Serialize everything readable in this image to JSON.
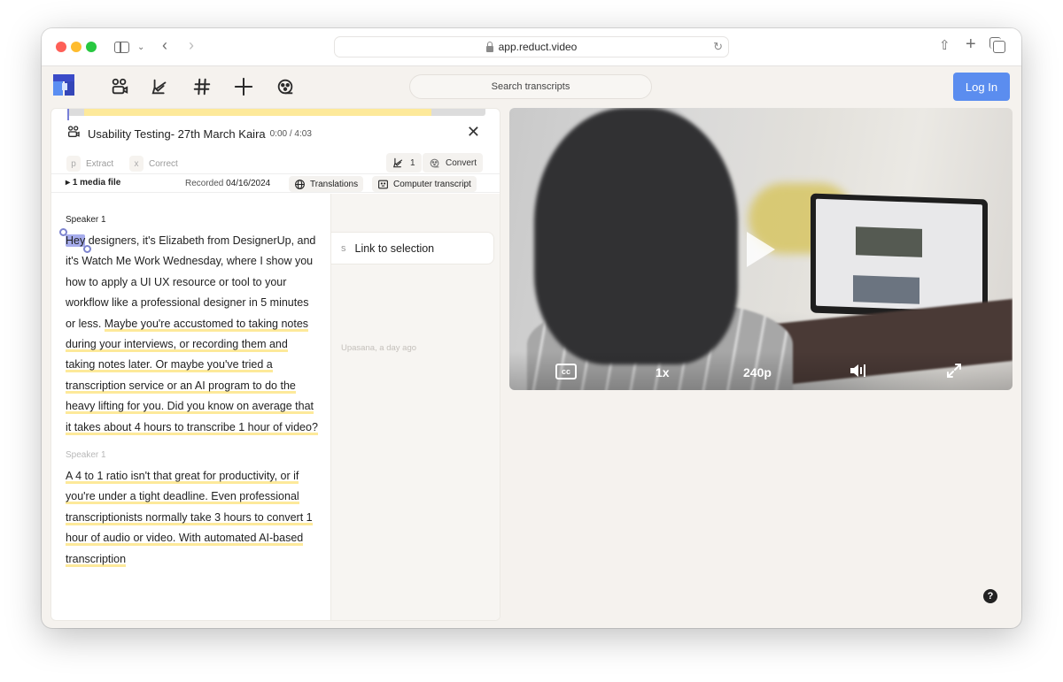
{
  "browser": {
    "url": "app.reduct.video",
    "icons": [
      "sidebar-icon",
      "chevron-down-icon",
      "back-icon",
      "forward-icon",
      "lock-icon",
      "reload-icon",
      "share-icon",
      "new-tab-icon",
      "tabs-overview-icon"
    ]
  },
  "toolbar": {
    "icons": [
      "people-icon",
      "highlighter-icon",
      "hashtag-icon",
      "plus-icon",
      "film-reel-icon"
    ],
    "search_placeholder": "Search transcripts",
    "login_label": "Log In",
    "accent_color": "#5b8def"
  },
  "card": {
    "progress_fraction": 0.97,
    "title": "Usability Testing- 27th March Kaira",
    "time": "0:00 / 4:03",
    "extract": {
      "key": "p",
      "label": "Extract"
    },
    "correct": {
      "key": "x",
      "label": "Correct"
    },
    "highlights_count": "1",
    "convert_label": "Convert",
    "media_files": "1 media file",
    "recorded_label": "Recorded",
    "recorded_date": "04/16/2024",
    "translations_label": "Translations",
    "computer_transcript_label": "Computer transcript"
  },
  "transcript": {
    "blocks": [
      {
        "speaker": "Speaker 1",
        "selected_word": "Hey",
        "plain_text": " designers, it's Elizabeth from DesignerUp, and it's Watch Me Work Wednesday, where I show you how to apply a UI UX resource or tool to your workflow like a professional designer in 5 minutes or less. ",
        "highlighted_text": "Maybe you're accustomed to taking notes during your interviews, or recording them and taking notes later. Or maybe you've tried a transcription service or an AI program to do the heavy lifting for you. Did you know on average that it takes about 4 hours to transcribe 1 hour of video?"
      },
      {
        "speaker": "Speaker 1",
        "highlighted_text": "A 4 to 1 ratio isn't that great for productivity, or if you're under a tight deadline. Even professional transcriptionists normally take 3 hours to convert 1 hour of audio or video. With automated AI-based transcription"
      }
    ],
    "highlight_color": "#fde99a",
    "selection_color": "#a6acec"
  },
  "comments": {
    "link_key": "s",
    "link_label": "Link to selection",
    "author": "Upasana, a day ago"
  },
  "video": {
    "cc_label": "cc",
    "speed": "1x",
    "quality": "240p",
    "icons": [
      "play-icon",
      "volume-icon",
      "fullscreen-icon"
    ]
  },
  "help_label": "?"
}
